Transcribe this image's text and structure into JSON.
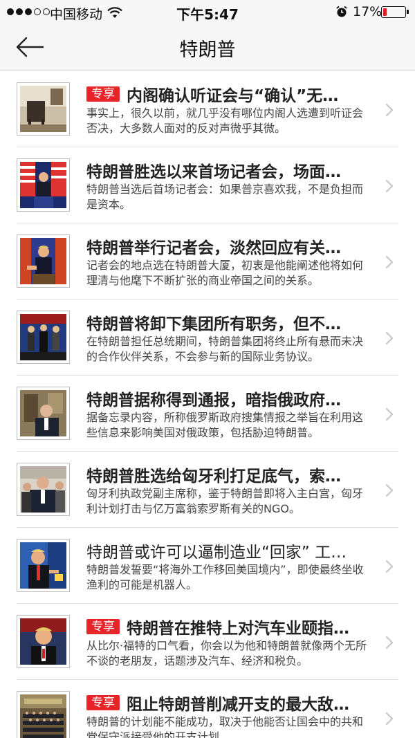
{
  "status_bar": {
    "carrier": "中国移动",
    "time": "下午5:47",
    "battery": "17%",
    "battery_level": 0.17
  },
  "nav": {
    "title": "特朗普",
    "back_icon": "arrow-left-icon"
  },
  "tag_label": "专享",
  "articles": [
    {
      "tagged": true,
      "title": "内阁确认听证会与“确认”无…",
      "summary": "事实上，很久以前，就几乎没有哪位内阁人选遭到听证会否决，大多数人面对的反对声微乎其微。"
    },
    {
      "tagged": false,
      "title": "特朗普胜选以来首场记者会，场面…",
      "summary": "特朗普当选后首场记者会：如果普京喜欢我，不是负担而是资本。"
    },
    {
      "tagged": false,
      "title": "特朗普举行记者会，淡然回应有关…",
      "summary": "记者会的地点选在特朗普大厦，初衷是他能阐述他将如何理清与他麾下不断扩张的商业帝国之间的关系。"
    },
    {
      "tagged": false,
      "title": "特朗普将卸下集团所有职务，但不…",
      "summary": "在特朗普担任总统期间，特朗普集团将终止所有悬而未决的合作伙伴关系，不会参与新的国际业务协议。"
    },
    {
      "tagged": false,
      "title": "特朗普据称得到通报，暗指俄政府…",
      "summary": "据备忘录内容，所称俄罗斯政府搜集情报之举旨在利用这些信息来影响美国对俄政策，包括胁迫特朗普。"
    },
    {
      "tagged": false,
      "title": "特朗普胜选给匈牙利打足底气，索…",
      "summary": "匈牙利执政党副主席称，鉴于特朗普即将入主白宫，匈牙利计划打击与亿万富翁索罗斯有关的NGO。"
    },
    {
      "tagged": false,
      "light": true,
      "title": "特朗普或许可以逼制造业“回家” 工…",
      "summary": "特朗普发誓要“将海外工作移回美国境内”，即使最终坐收渔利的可能是机器人。"
    },
    {
      "tagged": true,
      "title": "特朗普在推特上对汽车业颐指…",
      "summary": "从比尔·福特的口气看，你会以为他和特朗普就像两个无所不谈的老朋友，话题涉及汽车、经济和税负。"
    },
    {
      "tagged": true,
      "title": "阻止特朗普削减开支的最大敌…",
      "summary": "特朗普的计划能不能成功，取决于他能否让国会中的共和党保守派接受他的开支计划。"
    }
  ]
}
